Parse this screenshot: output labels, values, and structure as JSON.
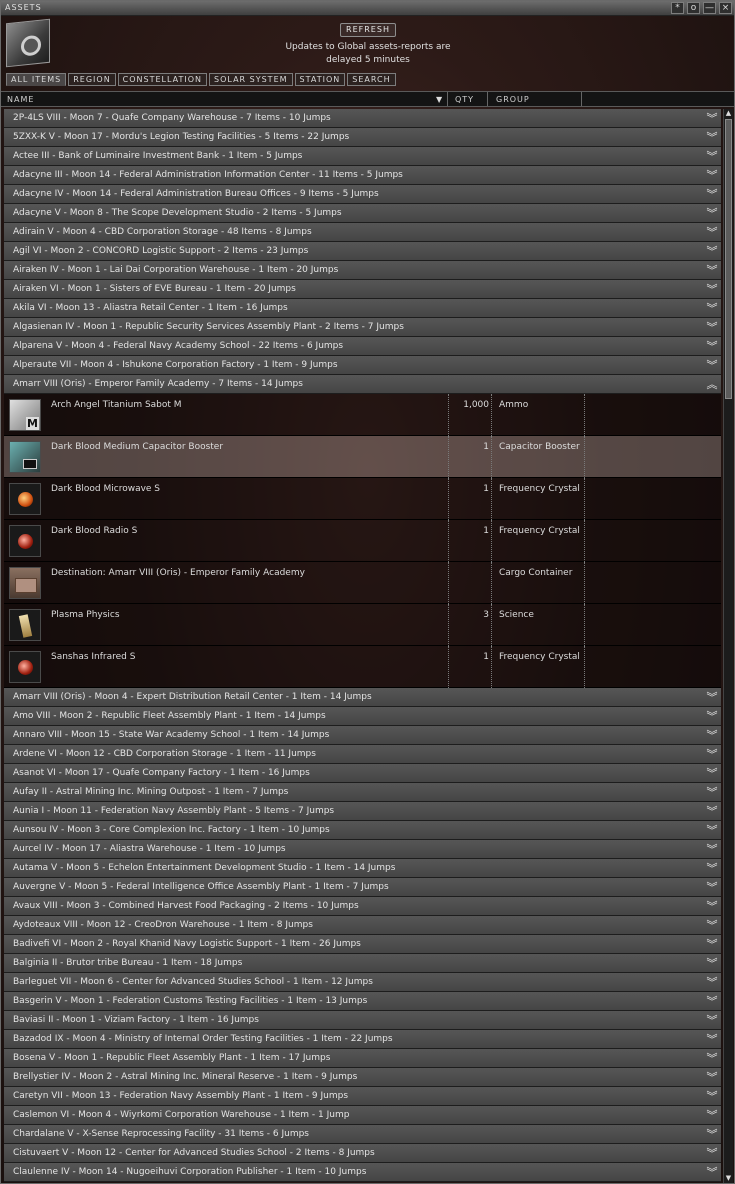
{
  "window": {
    "title": "ASSETS"
  },
  "titlebar_buttons": [
    "*",
    "o",
    "—",
    "×"
  ],
  "header": {
    "refresh_label": "REFRESH",
    "notice_line1": "Updates to Global assets-reports are",
    "notice_line2": "delayed 5 minutes"
  },
  "tabs": [
    "ALL ITEMS",
    "REGION",
    "CONSTELLATION",
    "SOLAR SYSTEM",
    "STATION",
    "SEARCH"
  ],
  "columns": {
    "name": "NAME",
    "qty": "QTY",
    "group": "GROUP"
  },
  "groups_before": [
    "2P-4LS VIII - Moon 7 - Quafe Company Warehouse - 7 Items - 10 Jumps",
    "5ZXX-K V - Moon 17 - Mordu's Legion Testing Facilities - 5 Items - 22 Jumps",
    "Actee III - Bank of Luminaire Investment Bank - 1 Item - 5 Jumps",
    "Adacyne III - Moon 14 - Federal Administration Information Center - 11 Items - 5 Jumps",
    "Adacyne IV - Moon 14 - Federal Administration Bureau Offices - 9 Items - 5 Jumps",
    "Adacyne V - Moon 8 - The Scope Development Studio - 2 Items - 5 Jumps",
    "Adirain V - Moon 4 - CBD Corporation Storage - 48 Items - 8 Jumps",
    "Agil VI - Moon 2 - CONCORD Logistic Support - 2 Items - 23 Jumps",
    "Airaken IV - Moon 1 - Lai Dai Corporation Warehouse - 1 Item - 20 Jumps",
    "Airaken VI - Moon 1 - Sisters of EVE Bureau - 1 Item - 20 Jumps",
    "Akila VI - Moon 13 - Aliastra Retail Center - 1 Item - 16 Jumps",
    "Algasienan IV - Moon 1 - Republic Security Services Assembly Plant - 2 Items - 7 Jumps",
    "Alparena V - Moon 4 - Federal Navy Academy School - 22 Items - 6 Jumps",
    "Alperaute VII - Moon 4 - Ishukone Corporation Factory - 1 Item - 9 Jumps"
  ],
  "expanded_group": "Amarr VIII (Oris) - Emperor Family Academy - 7 Items - 14 Jumps",
  "expanded_items": [
    {
      "name": "Arch Angel Titanium Sabot M",
      "qty": "1,000",
      "group": "Ammo",
      "icon": "ammo-icon"
    },
    {
      "name": "Dark Blood Medium Capacitor Booster",
      "qty": "1",
      "group": "Capacitor Booster",
      "icon": "capacitor-booster-icon"
    },
    {
      "name": "Dark Blood Microwave S",
      "qty": "1",
      "group": "Frequency Crystal",
      "icon": "crystal-icon"
    },
    {
      "name": "Dark Blood Radio S",
      "qty": "1",
      "group": "Frequency Crystal",
      "icon": "crystal-icon"
    },
    {
      "name": "Destination: Amarr VIII (Oris) - Emperor Family Academy",
      "qty": "",
      "group": "Cargo Container",
      "icon": "cargo-container-icon"
    },
    {
      "name": "Plasma Physics",
      "qty": "3",
      "group": "Science",
      "icon": "skillbook-icon"
    },
    {
      "name": "Sanshas Infrared S",
      "qty": "1",
      "group": "Frequency Crystal",
      "icon": "crystal-icon"
    }
  ],
  "groups_after": [
    "Amarr VIII (Oris) - Moon 4 - Expert Distribution Retail Center - 1 Item - 14 Jumps",
    "Amo VIII - Moon 2 - Republic Fleet Assembly Plant - 1 Item - 14 Jumps",
    "Annaro VIII - Moon 15 - State War Academy School - 1 Item - 14 Jumps",
    "Ardene VI - Moon 12 - CBD Corporation Storage - 1 Item - 11 Jumps",
    "Asanot VI - Moon 17 - Quafe Company Factory - 1 Item - 16 Jumps",
    "Aufay II - Astral Mining Inc. Mining Outpost - 1 Item - 7 Jumps",
    "Aunia I - Moon 11 - Federation Navy Assembly Plant - 5 Items - 7 Jumps",
    "Aunsou IV - Moon 3 - Core Complexion Inc. Factory - 1 Item - 10 Jumps",
    "Aurcel IV - Moon 17 - Aliastra Warehouse - 1 Item - 10 Jumps",
    "Autama V - Moon 5 - Echelon Entertainment Development Studio - 1 Item - 14 Jumps",
    "Auvergne V - Moon 5 - Federal Intelligence Office Assembly Plant - 1 Item - 7 Jumps",
    "Avaux VIII - Moon 3 - Combined Harvest Food Packaging - 2 Items - 10 Jumps",
    "Aydoteaux VIII - Moon 12 - CreoDron Warehouse - 1 Item - 8 Jumps",
    "Badivefi VI - Moon 2 - Royal Khanid Navy Logistic Support - 1 Item - 26 Jumps",
    "Balginia II - Brutor tribe Bureau - 1 Item - 18 Jumps",
    "Barleguet VII - Moon 6 - Center for Advanced Studies School - 1 Item - 12 Jumps",
    "Basgerin V - Moon 1 - Federation Customs Testing Facilities - 1 Item - 13 Jumps",
    "Baviasi II - Moon 1 - Viziam Factory - 1 Item - 16 Jumps",
    "Bazadod IX - Moon 4 - Ministry of Internal Order Testing Facilities - 1 Item - 22 Jumps",
    "Bosena V - Moon 1 - Republic Fleet Assembly Plant - 1 Item - 17 Jumps",
    "Brellystier IV - Moon 2 - Astral Mining Inc. Mineral Reserve - 1 Item - 9 Jumps",
    "Caretyn VII - Moon 13 - Federation Navy Assembly Plant - 1 Item - 9 Jumps",
    "Caslemon VI - Moon 4 - Wiyrkomi Corporation Warehouse - 1 Item - 1 Jump",
    "Chardalane V - X-Sense Reprocessing Facility - 31 Items - 6 Jumps",
    "Cistuvaert V - Moon 12 - Center for Advanced Studies School - 2 Items - 8 Jumps",
    "Claulenne IV - Moon 14 - Nugoeihuvi Corporation Publisher - 1 Item - 10 Jumps"
  ],
  "selected_item_index": 1
}
